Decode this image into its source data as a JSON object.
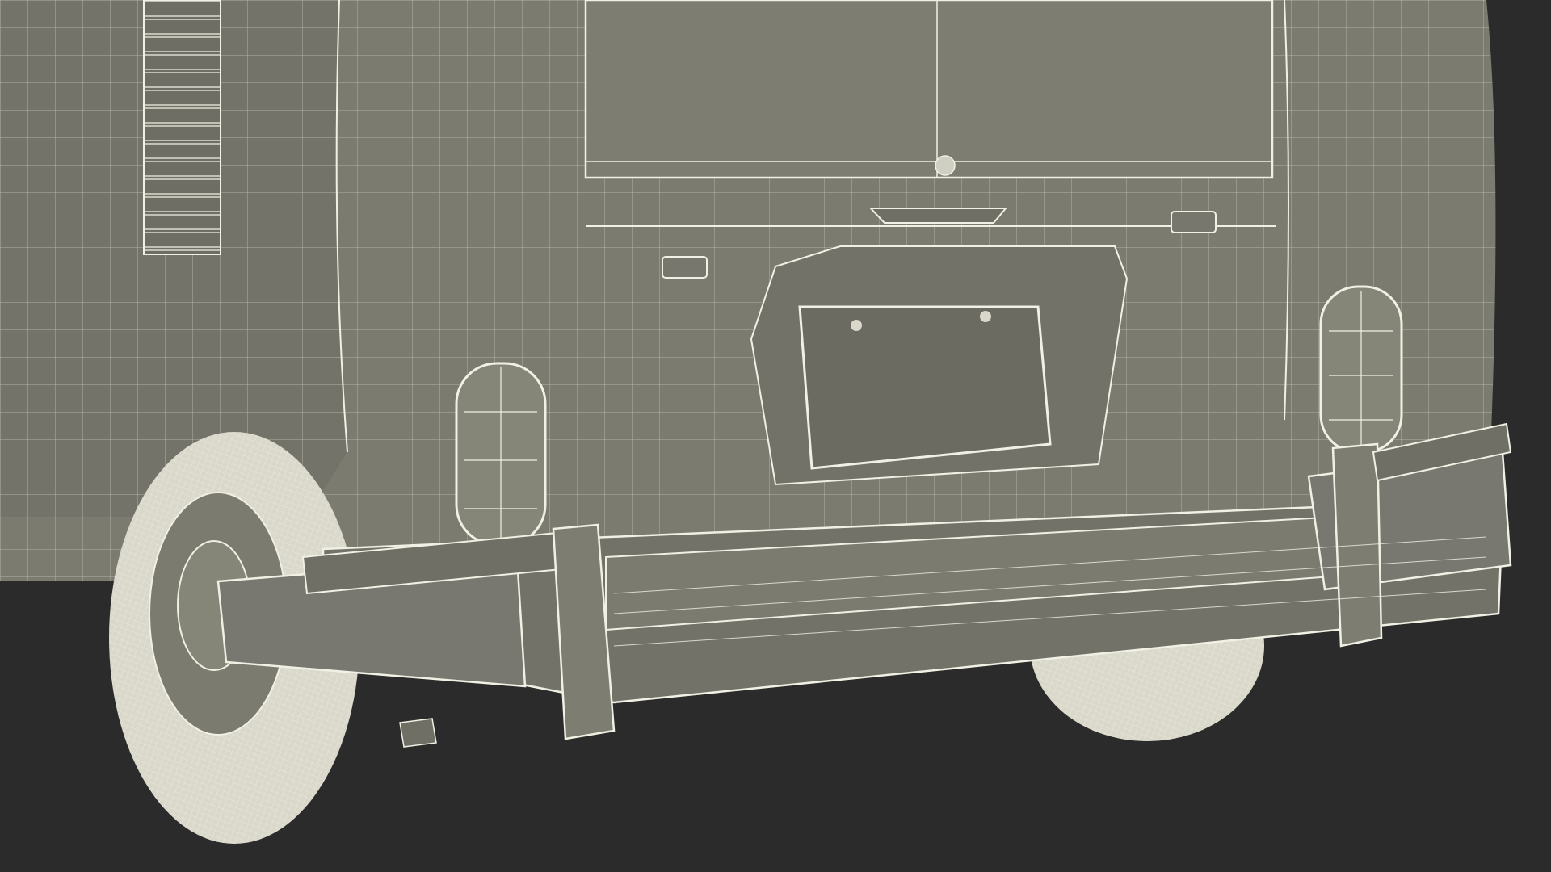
{
  "scene": {
    "subject": "wireframe-render",
    "colors": {
      "background": "#2b2b2b",
      "body": "#7b7b70",
      "body_dark": "#6c6c62",
      "body_light": "#878779",
      "wire": "#f1f0e4",
      "shadow": "#5a5a52",
      "tire": "#e2e1d4"
    },
    "icons": [
      "wireframe-mesh-icon"
    ]
  }
}
